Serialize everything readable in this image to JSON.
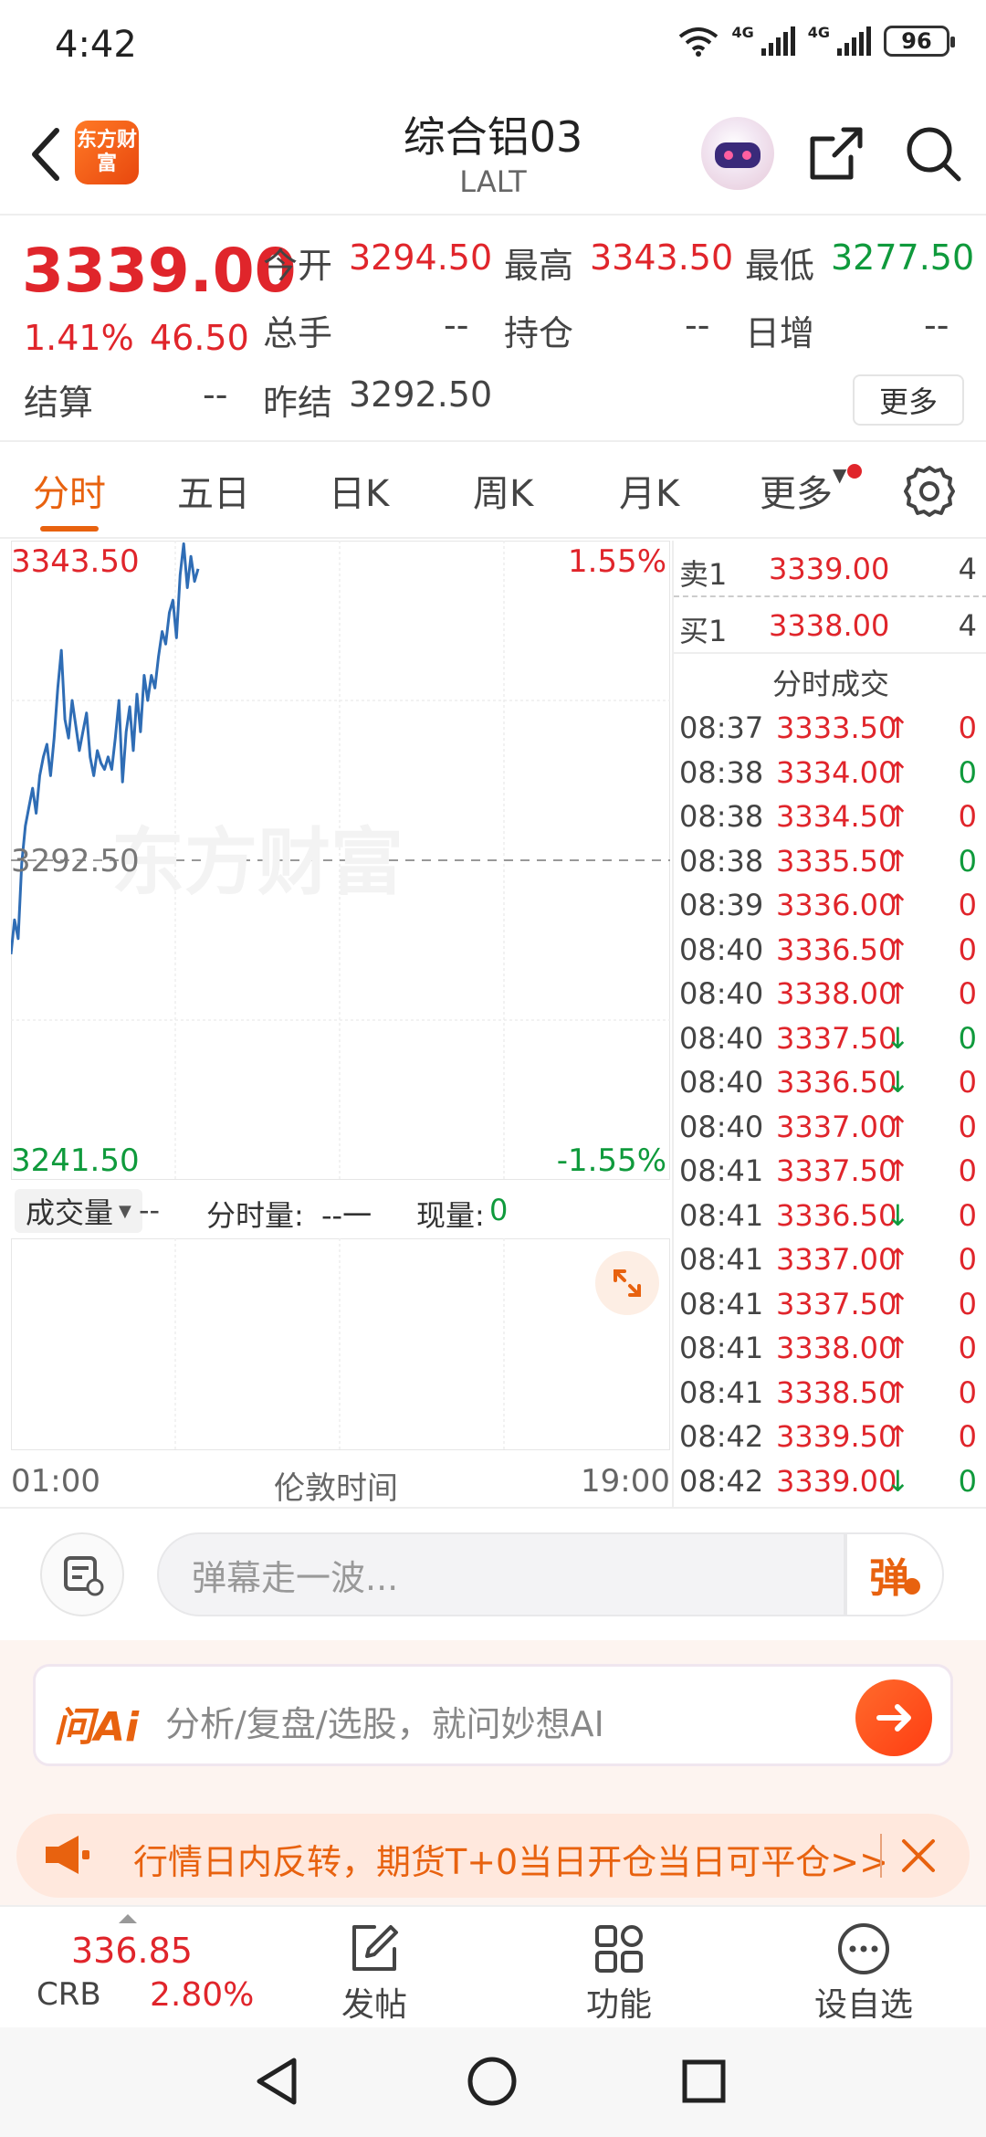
{
  "status_bar": {
    "time": "4:42",
    "network_1": "4G",
    "network_2": "4G",
    "battery": "96"
  },
  "nav": {
    "brand_logo_text": "东方财富",
    "title": "综合铝03",
    "subtitle": "LALT"
  },
  "quote": {
    "last_price": "3339.00",
    "change_pct": "1.41%",
    "change_amt": "46.50",
    "open_label": "今开",
    "open_value": "3294.50",
    "high_label": "最高",
    "high_value": "3343.50",
    "low_label": "最低",
    "low_value": "3277.50",
    "volume_label": "总手",
    "volume_value": "--",
    "position_label": "持仓",
    "position_value": "--",
    "daily_inc_label": "日增",
    "daily_inc_value": "--",
    "settle_label": "结算",
    "settle_value": "--",
    "prev_settle_label": "昨结",
    "prev_settle_value": "3292.50",
    "more_label": "更多"
  },
  "tabs": [
    {
      "label": "分时",
      "active": true
    },
    {
      "label": "五日"
    },
    {
      "label": "日K"
    },
    {
      "label": "周K"
    },
    {
      "label": "月K"
    },
    {
      "label": "更多"
    }
  ],
  "chart": {
    "watermark": "东方财富",
    "y_top_label": "3343.50",
    "y_top_pct": "1.55%",
    "y_mid_label": "3292.50",
    "y_bottom_label": "3241.50",
    "y_bottom_pct": "-1.55%",
    "volume_selector": "成交量",
    "volume_value": "--",
    "intraday_volume_label": "分时量:",
    "intraday_volume_value": "--一",
    "current_volume_label": "现量:",
    "current_volume_value": "0",
    "time_start": "01:00",
    "time_zone": "伦敦时间",
    "time_end": "19:00",
    "colors": {
      "line": "#2f6db5",
      "up": "#e0252b",
      "down": "#0f9a3c"
    }
  },
  "chart_data": {
    "type": "line",
    "title": "",
    "xlabel": "伦敦时间",
    "ylabel": "",
    "x_range": [
      "01:00",
      "19:00"
    ],
    "ylim": [
      3241.5,
      3343.5
    ],
    "reference_price": 3292.5,
    "series": [
      {
        "values": [
          3277.5,
          3283,
          3280,
          3292,
          3298,
          3301,
          3304,
          3300,
          3306,
          3309,
          3311,
          3306,
          3312,
          3320,
          3326,
          3315,
          3312,
          3318,
          3314,
          3310,
          3313,
          3316,
          3309,
          3306,
          3310,
          3308,
          3307,
          3309,
          3307,
          3312,
          3318,
          3305,
          3313,
          3317,
          3310,
          3319,
          3313,
          3322,
          3318,
          3322,
          3320,
          3325,
          3329,
          3327,
          3332,
          3334,
          3328,
          3338,
          3343,
          3336,
          3341,
          3337,
          3339
        ]
      }
    ]
  },
  "order_book": {
    "ask_label": "卖1",
    "ask_price": "3339.00",
    "ask_qty": "4",
    "bid_label": "买1",
    "bid_price": "3338.00",
    "bid_qty": "4",
    "ticks_title": "分时成交"
  },
  "ticks": [
    {
      "time": "08:37",
      "price": "3333.50",
      "dir": "↑",
      "vol": "0",
      "vol_color": "red"
    },
    {
      "time": "08:38",
      "price": "3334.00",
      "dir": "↑",
      "vol": "0",
      "vol_color": "green"
    },
    {
      "time": "08:38",
      "price": "3334.50",
      "dir": "↑",
      "vol": "0",
      "vol_color": "red"
    },
    {
      "time": "08:38",
      "price": "3335.50",
      "dir": "↑",
      "vol": "0",
      "vol_color": "green"
    },
    {
      "time": "08:39",
      "price": "3336.00",
      "dir": "↑",
      "vol": "0",
      "vol_color": "red"
    },
    {
      "time": "08:40",
      "price": "3336.50",
      "dir": "↑",
      "vol": "0",
      "vol_color": "red"
    },
    {
      "time": "08:40",
      "price": "3338.00",
      "dir": "↑",
      "vol": "0",
      "vol_color": "red"
    },
    {
      "time": "08:40",
      "price": "3337.50",
      "dir": "↓",
      "vol": "0",
      "vol_color": "green"
    },
    {
      "time": "08:40",
      "price": "3336.50",
      "dir": "↓",
      "vol": "0",
      "vol_color": "red"
    },
    {
      "time": "08:40",
      "price": "3337.00",
      "dir": "↑",
      "vol": "0",
      "vol_color": "red"
    },
    {
      "time": "08:41",
      "price": "3337.50",
      "dir": "↑",
      "vol": "0",
      "vol_color": "red"
    },
    {
      "time": "08:41",
      "price": "3336.50",
      "dir": "↓",
      "vol": "0",
      "vol_color": "red"
    },
    {
      "time": "08:41",
      "price": "3337.00",
      "dir": "↑",
      "vol": "0",
      "vol_color": "red"
    },
    {
      "time": "08:41",
      "price": "3337.50",
      "dir": "↑",
      "vol": "0",
      "vol_color": "red"
    },
    {
      "time": "08:41",
      "price": "3338.00",
      "dir": "↑",
      "vol": "0",
      "vol_color": "red"
    },
    {
      "time": "08:41",
      "price": "3338.50",
      "dir": "↑",
      "vol": "0",
      "vol_color": "red"
    },
    {
      "time": "08:42",
      "price": "3339.50",
      "dir": "↑",
      "vol": "0",
      "vol_color": "red"
    },
    {
      "time": "08:42",
      "price": "3339.00",
      "dir": "↓",
      "vol": "0",
      "vol_color": "green"
    }
  ],
  "danmaku": {
    "placeholder": "弹幕走一波...",
    "send_label": "弹"
  },
  "ai_ask": {
    "logo": "问Ai",
    "placeholder": "分析/复盘/选股，就问妙想AI"
  },
  "promo": {
    "text": "行情日内反转，期货T+0当日开仓当日可平仓>>"
  },
  "bottom_bar": {
    "index_price": "336.85",
    "index_name": "CRB",
    "index_pct": "2.80%",
    "actions": [
      {
        "label": "发帖"
      },
      {
        "label": "功能"
      },
      {
        "label": "设自选"
      }
    ]
  }
}
